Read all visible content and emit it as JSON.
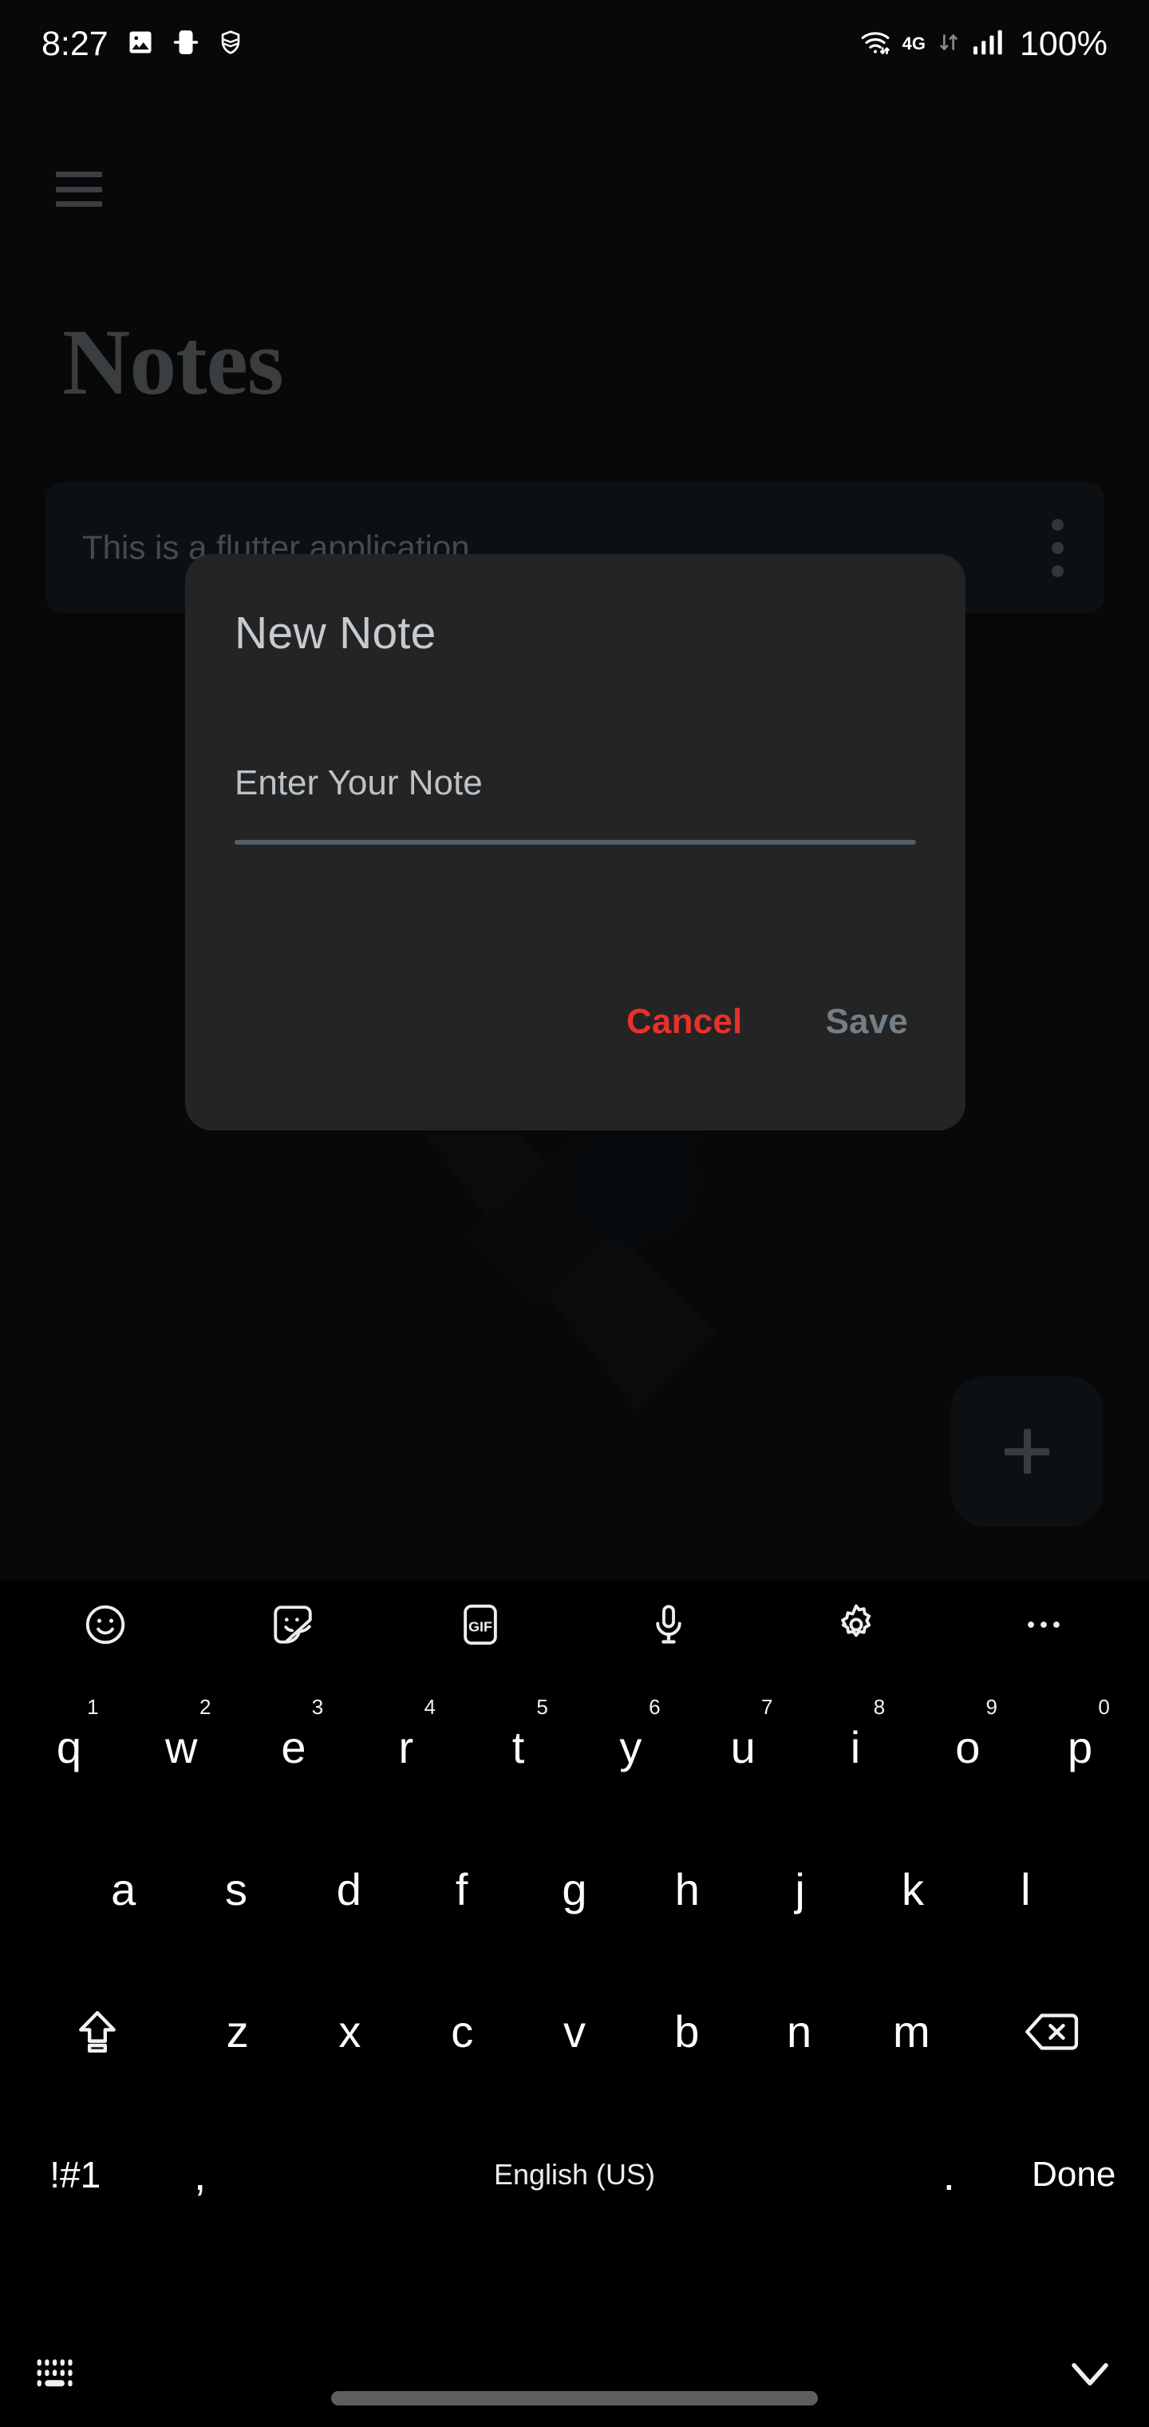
{
  "status_bar": {
    "time": "8:27",
    "battery": "100%",
    "network_type": "4G",
    "icons": [
      "image-icon",
      "phone-link-icon",
      "shield-icon",
      "wifi-icon",
      "data-transfer-icon",
      "signal-bars-icon"
    ]
  },
  "app": {
    "title": "Notes",
    "menu_icon": "hamburger-menu-icon",
    "fab_label": "+",
    "notes": [
      {
        "text": "This is a flutter application",
        "overflow_icon": "more-vertical-icon"
      }
    ]
  },
  "dialog": {
    "title": "New Note",
    "field_label": "Enter Your Note",
    "field_value": "",
    "cancel_label": "Cancel",
    "save_label": "Save",
    "cancel_color": "#E8312B",
    "save_color": "#757E85",
    "background": "#242424"
  },
  "keyboard": {
    "toolbar": [
      "emoji-icon",
      "sticker-icon",
      "gif-icon",
      "microphone-icon",
      "settings-gear-icon",
      "more-horizontal-icon"
    ],
    "row1": [
      {
        "key": "q",
        "num": "1"
      },
      {
        "key": "w",
        "num": "2"
      },
      {
        "key": "e",
        "num": "3"
      },
      {
        "key": "r",
        "num": "4"
      },
      {
        "key": "t",
        "num": "5"
      },
      {
        "key": "y",
        "num": "6"
      },
      {
        "key": "u",
        "num": "7"
      },
      {
        "key": "i",
        "num": "8"
      },
      {
        "key": "o",
        "num": "9"
      },
      {
        "key": "p",
        "num": "0"
      }
    ],
    "row2": [
      "a",
      "s",
      "d",
      "f",
      "g",
      "h",
      "j",
      "k",
      "l"
    ],
    "row3": {
      "shift": "shift-icon",
      "keys": [
        "z",
        "x",
        "c",
        "v",
        "b",
        "n",
        "m"
      ],
      "backspace": "backspace-icon"
    },
    "row4": {
      "symbols": "!#1",
      "comma": ",",
      "space": "English (US)",
      "period": ".",
      "done": "Done"
    },
    "bottom": {
      "layout_icon": "keyboard-layout-icon",
      "hide_icon": "chevron-down-icon"
    }
  }
}
